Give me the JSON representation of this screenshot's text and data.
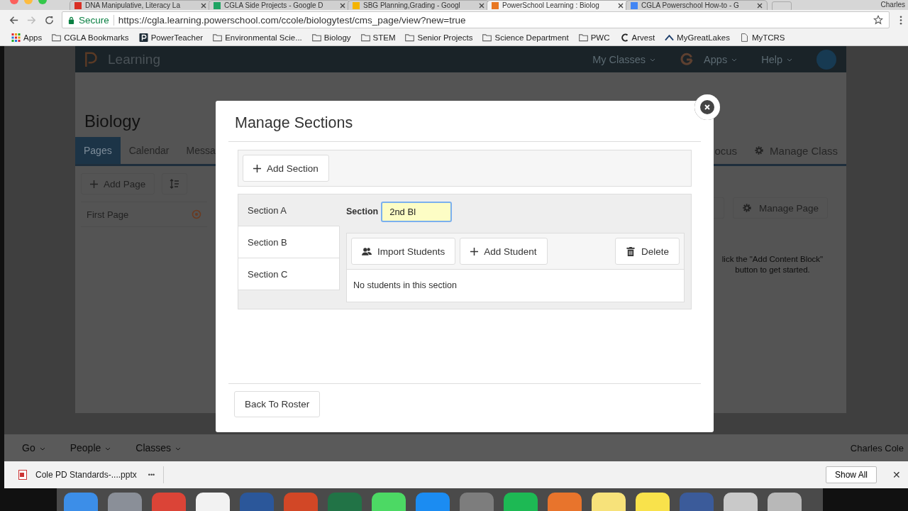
{
  "browser": {
    "tabs": [
      {
        "title": "DNA Manipulative, Literacy La",
        "color": "#d93025",
        "selected": false
      },
      {
        "title": "CGLA Side Projects - Google D",
        "color": "#1fa463",
        "selected": false
      },
      {
        "title": "SBG Planning,Grading - Googl",
        "color": "#f4b400",
        "selected": false
      },
      {
        "title": "PowerSchool Learning : Biolog",
        "color": "#e87722",
        "selected": true
      },
      {
        "title": "CGLA Powerschool How-to - G",
        "color": "#4285f4",
        "selected": false
      }
    ],
    "profile": "Charles",
    "address": {
      "secure_label": "Secure",
      "url": "https://cgla.learning.powerschool.com/ccole/biologytest/cms_page/view?new=true"
    },
    "bookmarks": [
      {
        "label": "Apps",
        "kind": "grid"
      },
      {
        "label": "CGLA Bookmarks",
        "kind": "folder"
      },
      {
        "label": "PowerTeacher",
        "kind": "logo"
      },
      {
        "label": "Environmental Scie...",
        "kind": "folder"
      },
      {
        "label": "Biology",
        "kind": "folder"
      },
      {
        "label": "STEM",
        "kind": "folder"
      },
      {
        "label": "Senior Projects",
        "kind": "folder"
      },
      {
        "label": "Science Department",
        "kind": "folder"
      },
      {
        "label": "PWC",
        "kind": "folder"
      },
      {
        "label": "Arvest",
        "kind": "crescent"
      },
      {
        "label": "MyGreatLakes",
        "kind": "chevron"
      },
      {
        "label": "MyTCRS",
        "kind": "page"
      }
    ]
  },
  "site": {
    "logo": "Learning",
    "nav": [
      "My Classes",
      "Apps",
      "Help"
    ],
    "class_title": "Biology",
    "tabs": [
      {
        "label": "Pages",
        "selected": true
      },
      {
        "label": "Calendar",
        "selected": false
      },
      {
        "label": "Messa",
        "selected": false
      }
    ],
    "tabs_right": [
      "ocus",
      "Manage Class"
    ],
    "add_page": "Add Page",
    "pages": [
      "First Page"
    ],
    "manage_page": "Manage Page",
    "empty_hint": "lick the \"Add Content Block\"\nbutton to get started."
  },
  "modal": {
    "title": "Manage Sections",
    "add_section": "Add Section",
    "sections": [
      {
        "label": "Section A",
        "selected": true
      },
      {
        "label": "Section B",
        "selected": false
      },
      {
        "label": "Section C",
        "selected": false
      }
    ],
    "field_label": "Section",
    "field_value": "2nd Bl",
    "field_focused": true,
    "import_students": "Import Students",
    "add_student": "Add Student",
    "delete": "Delete",
    "empty_students": "No students in this section",
    "back": "Back To Roster"
  },
  "footer_bar": {
    "menus": [
      "Go",
      "People",
      "Classes"
    ],
    "user": "Charles Cole"
  },
  "downloads": {
    "file": "Cole PD Standards-....pptx",
    "more": "•••",
    "show_all": "Show All",
    "close": "✕"
  },
  "dock": [
    {
      "color": "#3c8ee8"
    },
    {
      "color": "#8a8f98"
    },
    {
      "color": "#db4437"
    },
    {
      "color": "#f2f2f2"
    },
    {
      "color": "#2b579a"
    },
    {
      "color": "#d24726"
    },
    {
      "color": "#217346"
    },
    {
      "color": "#4cd964"
    },
    {
      "color": "#1b8cf2"
    },
    {
      "color": "#7d7d7d"
    },
    {
      "color": "#1db954"
    },
    {
      "color": "#e8742c"
    },
    {
      "color": "#f7e27a"
    },
    {
      "color": "#f9e24b"
    },
    {
      "color": "#3b5b9a"
    },
    {
      "color": "#c9c9c9"
    },
    {
      "color": "#b8b8b8"
    }
  ]
}
